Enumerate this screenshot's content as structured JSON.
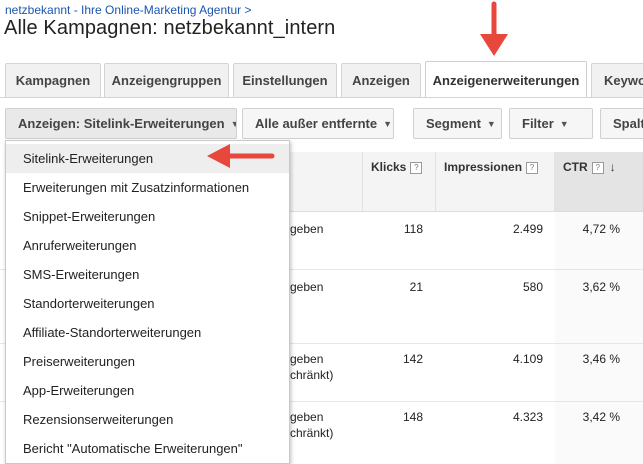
{
  "header": {
    "breadcrumb": "netzbekannt - Ihre Online-Marketing Agentur >",
    "title": "Alle Kampagnen: netzbekannt_intern"
  },
  "tabs": [
    {
      "label": "Kampagnen",
      "active": false
    },
    {
      "label": "Anzeigengruppen",
      "active": false
    },
    {
      "label": "Einstellungen",
      "active": false
    },
    {
      "label": "Anzeigen",
      "active": false
    },
    {
      "label": "Anzeigenerweiterungen",
      "active": true
    },
    {
      "label": "Keywo",
      "active": false
    }
  ],
  "toolbar": {
    "view_select": "Anzeigen: Sitelink-Erweiterungen",
    "status_filter": "Alle außer entfernte",
    "segment": "Segment",
    "filter": "Filter",
    "columns": "Spalt"
  },
  "table": {
    "columns": [
      "Klicks",
      "Impressionen",
      "CTR"
    ],
    "sorted_column": "CTR",
    "help_glyph": "?",
    "rows": [
      {
        "status_line1": "geben",
        "status_line2": "",
        "clicks": "118",
        "impressions": "2.499",
        "ctr": "4,72 %"
      },
      {
        "status_line1": "geben",
        "status_line2": "",
        "clicks": "21",
        "impressions": "580",
        "ctr": "3,62 %"
      },
      {
        "status_line1": "geben",
        "status_line2": "chränkt)",
        "clicks": "142",
        "impressions": "4.109",
        "ctr": "3,46 %"
      },
      {
        "status_line1": "geben",
        "status_line2": "chränkt)",
        "clicks": "148",
        "impressions": "4.323",
        "ctr": "3,42 %"
      }
    ]
  },
  "dropdown": {
    "selected_index": 0,
    "items": [
      "Sitelink-Erweiterungen",
      "Erweiterungen mit Zusatzinformationen",
      "Snippet-Erweiterungen",
      "Anruferweiterungen",
      "SMS-Erweiterungen",
      "Standorterweiterungen",
      "Affiliate-Standorterweiterungen",
      "Preiserweiterungen",
      "App-Erweiterungen",
      "Rezensionserweiterungen",
      "Bericht \"Automatische Erweiterungen\""
    ]
  },
  "icons": {
    "caret": "▼",
    "sort_down": "↓"
  },
  "colors": {
    "annotation_arrow": "#e8473c",
    "link": "#1a55b0"
  }
}
